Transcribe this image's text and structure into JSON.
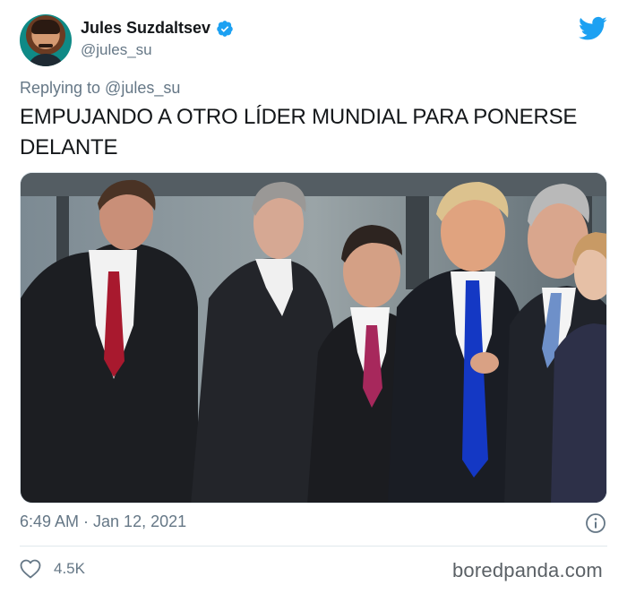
{
  "author": {
    "display_name": "Jules Suzdaltsev",
    "handle": "@jules_su",
    "avatar_icon": "profile-photo",
    "verified_icon": "verified-badge-icon"
  },
  "platform_icon": "twitter-bird-icon",
  "reply_context": "Replying to @jules_su",
  "tweet": {
    "text": "EMPUJANDO A OTRO LÍDER MUNDIAL PARA PONERSE DELANTE",
    "media_description": "photo-of-world-leaders"
  },
  "meta": {
    "timestamp": "6:49 AM · Jan 12, 2021",
    "info_icon": "info-icon"
  },
  "engagement": {
    "like_icon": "heart-icon",
    "like_count": "4.5K"
  },
  "watermark": "boredpanda.com",
  "colors": {
    "brand_blue": "#1da1f2",
    "secondary_text": "#657786",
    "primary_text": "#14171a"
  }
}
